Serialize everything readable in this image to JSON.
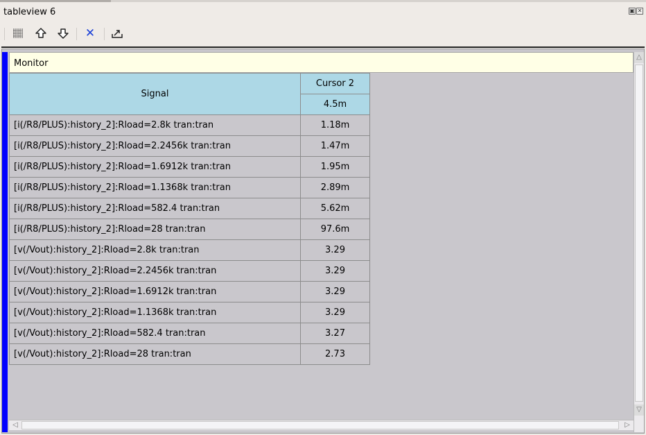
{
  "window": {
    "title": "tableview 6"
  },
  "toolbar": {
    "icons": [
      "table-grid-icon",
      "arrow-up-icon",
      "arrow-down-icon",
      "delete-icon",
      "export-icon"
    ]
  },
  "monitor": {
    "label": "Monitor"
  },
  "table": {
    "signal_header": "Signal",
    "cursor_header": "Cursor 2",
    "cursor_value": "4.5m",
    "rows": [
      {
        "signal": "[i(/R8/PLUS):history_2]:Rload=2.8k tran:tran",
        "value": "1.18m"
      },
      {
        "signal": "[i(/R8/PLUS):history_2]:Rload=2.2456k tran:tran",
        "value": "1.47m"
      },
      {
        "signal": "[i(/R8/PLUS):history_2]:Rload=1.6912k tran:tran",
        "value": "1.95m"
      },
      {
        "signal": "[i(/R8/PLUS):history_2]:Rload=1.1368k tran:tran",
        "value": "2.89m"
      },
      {
        "signal": "[i(/R8/PLUS):history_2]:Rload=582.4 tran:tran",
        "value": "5.62m"
      },
      {
        "signal": "[i(/R8/PLUS):history_2]:Rload=28 tran:tran",
        "value": "97.6m"
      },
      {
        "signal": "[v(/Vout):history_2]:Rload=2.8k tran:tran",
        "value": "3.29"
      },
      {
        "signal": "[v(/Vout):history_2]:Rload=2.2456k tran:tran",
        "value": "3.29"
      },
      {
        "signal": "[v(/Vout):history_2]:Rload=1.6912k tran:tran",
        "value": "3.29"
      },
      {
        "signal": "[v(/Vout):history_2]:Rload=1.1368k tran:tran",
        "value": "3.29"
      },
      {
        "signal": "[v(/Vout):history_2]:Rload=582.4 tran:tran",
        "value": "3.27"
      },
      {
        "signal": "[v(/Vout):history_2]:Rload=28 tran:tran",
        "value": "2.73"
      }
    ]
  },
  "colors": {
    "header_bg": "#add8e6",
    "monitor_bg": "#ffffe6",
    "left_bar": "#0000ff",
    "delete_icon": "#1a3fd8"
  }
}
